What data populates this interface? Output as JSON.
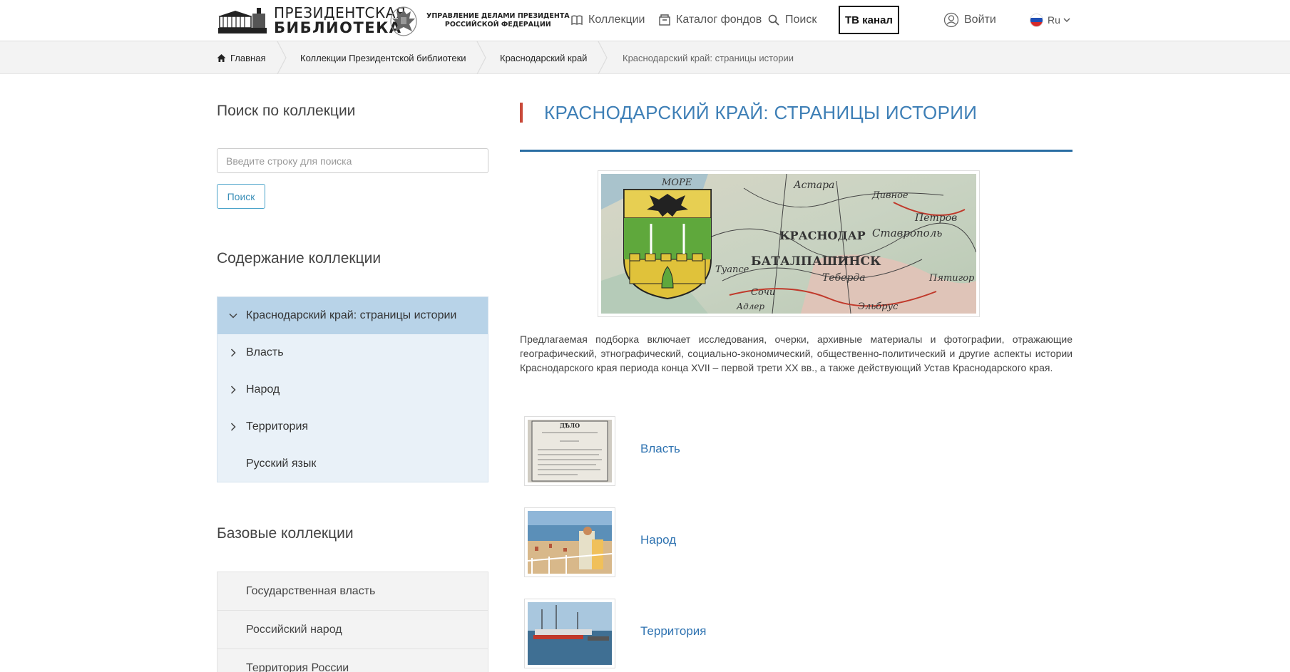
{
  "header": {
    "logo_line1": "ПРЕЗИДЕНТСКАЯ",
    "logo_line2": "БИБЛИОТЕКА",
    "uprav_line1": "УПРАВЛЕНИЕ ДЕЛАМИ ПРЕЗИДЕНТА",
    "uprav_line2": "РОССИЙСКОЙ ФЕДЕРАЦИИ",
    "nav": {
      "collections": "Коллекции",
      "catalog": "Каталог фондов",
      "search": "Поиск",
      "tv": "ТВ канал",
      "login": "Войти",
      "lang": "Ru"
    }
  },
  "breadcrumb": [
    "Главная",
    "Коллекции Президентской библиотеки",
    "Краснодарский край",
    "Краснодарский край: страницы истории"
  ],
  "sidebar": {
    "search_heading": "Поиск по коллекции",
    "search_placeholder": "Введите строку для поиска",
    "search_button": "Поиск",
    "contents_heading": "Содержание коллекции",
    "tree": [
      {
        "label": "Краснодарский край: страницы истории",
        "state": "expanded"
      },
      {
        "label": "Власть",
        "state": "collapsed"
      },
      {
        "label": "Народ",
        "state": "collapsed"
      },
      {
        "label": "Территория",
        "state": "collapsed"
      },
      {
        "label": "Русский язык",
        "state": "leaf"
      }
    ],
    "base_heading": "Базовые коллекции",
    "base_items": [
      "Государственная власть",
      "Российский народ",
      "Территория России"
    ]
  },
  "main": {
    "title": "КРАСНОДАРСКИЙ КРАЙ: СТРАНИЦЫ ИСТОРИИ",
    "description": "Предлагаемая подборка включает исследования, очерки, архивные материалы и фотографии, отражающие географический, этнографический, социально-экономический, общественно-политический и другие аспекты истории Краснодарского края периода конца XVII – первой трети XX вв., а также действующий Устав Краснодарского края.",
    "hero_map_labels": [
      "МОРЕ",
      "Астара",
      "Дивное",
      "КРАСНОДАР",
      "Ставрополь",
      "Петров",
      "БАТАЛПАШИНСК",
      "Туапсе",
      "Теберда",
      "Пятигор",
      "Сочи",
      "Адлер",
      "Эльбрус"
    ],
    "thumb1_caption": "ДѢЛО",
    "subsections": [
      "Власть",
      "Народ",
      "Территория"
    ]
  },
  "colors": {
    "accent": "#3e7fb6",
    "title_bar": "#c94a3a",
    "tree_bg": "#e9f1f8",
    "tree_active": "#b8d3e8"
  }
}
